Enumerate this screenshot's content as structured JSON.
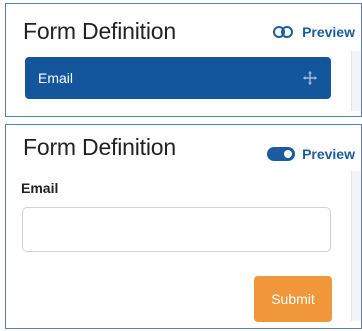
{
  "collapsed_view": {
    "title": "Form Definition",
    "preview_label": "Preview",
    "preview_toggle": "off",
    "field_card_label": "Email"
  },
  "preview_view": {
    "title": "Form Definition",
    "preview_label": "Preview",
    "preview_toggle": "on",
    "email_label": "Email",
    "email_value": "",
    "submit_label": "Submit"
  },
  "colors": {
    "accent_blue": "#14569c",
    "submit_orange": "#f0973a",
    "frame_border": "#5b7fb8"
  },
  "icons": [
    "toggle-off-icon",
    "move-icon",
    "toggle-on-icon"
  ]
}
